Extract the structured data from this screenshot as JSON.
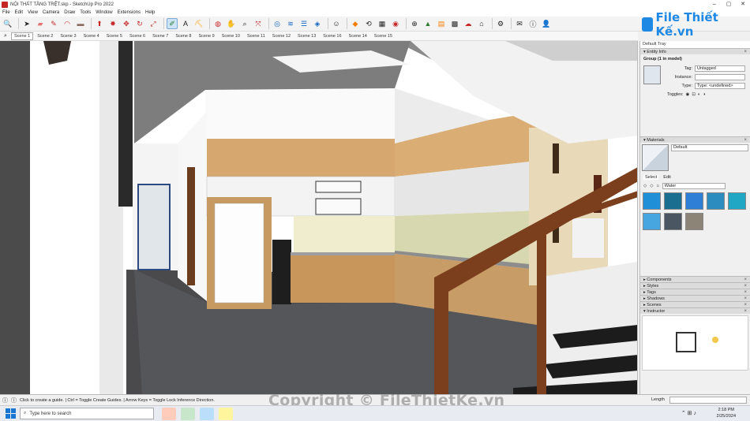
{
  "window": {
    "title": "NỘI THẤT TẦNG TRỆT.skp - SketchUp Pro 2022",
    "minimize": "–",
    "maximize": "▢",
    "close": "✕"
  },
  "menu": [
    "File",
    "Edit",
    "View",
    "Camera",
    "Draw",
    "Tools",
    "Window",
    "Extensions",
    "Help"
  ],
  "brand": {
    "logo_text": "File Thiết Kế.vn",
    "brand_color": "#1e88e5"
  },
  "scenes": [
    "Scene 1",
    "Scene 2",
    "Scene 3",
    "Scene 4",
    "Scene 5",
    "Scene 6",
    "Scene 7",
    "Scene 8",
    "Scene 9",
    "Scene 10",
    "Scene 11",
    "Scene 12",
    "Scene 13",
    "Scene 16",
    "Scene 14",
    "Scene 15"
  ],
  "active_scene": "Scene 1",
  "tray": {
    "title": "Default Tray",
    "entity_info": {
      "header": "Entity Info",
      "selection": "Group (1 in model)",
      "tag_label": "Tag:",
      "tag_value": "Untagged",
      "instance_label": "Instance:",
      "instance_value": "",
      "type_label": "Type:",
      "type_value": "Type: <undefined>",
      "toggles_label": "Toggles:"
    },
    "materials": {
      "header": "Materials",
      "current": "Default",
      "tab_select": "Select",
      "tab_edit": "Edit",
      "library": "Water"
    },
    "panels": [
      "Components",
      "Styles",
      "Tags",
      "Shadows",
      "Scenes",
      "Instructor"
    ]
  },
  "status": {
    "message": "Click to create a guide. | Ctrl = Toggle Create Guides. | Arrow Keys = Toggle Lock Inference Direction.",
    "measure_label": "Length"
  },
  "watermark": "Copyright © FileThietKe.vn",
  "taskbar": {
    "search_placeholder": "Type here to search",
    "time": "2:18 PM",
    "date": "2/25/2024"
  }
}
